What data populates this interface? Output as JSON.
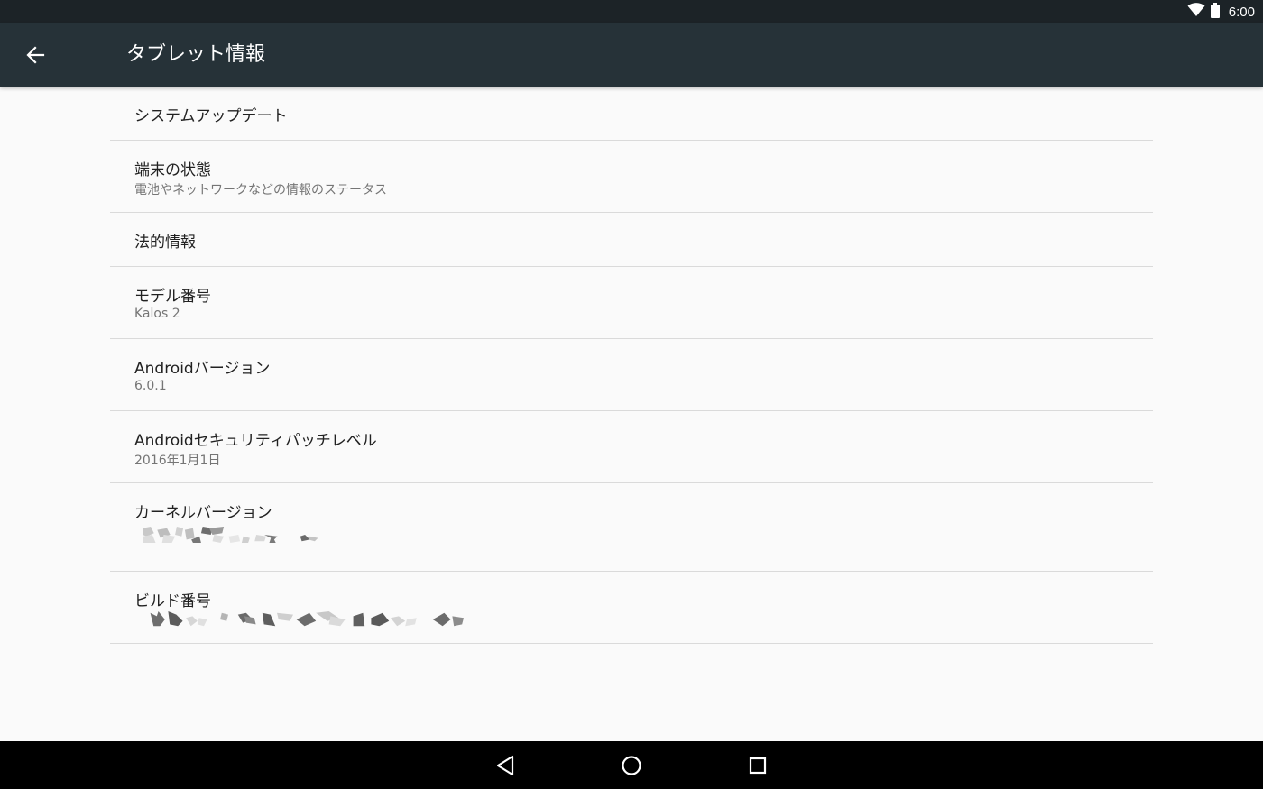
{
  "status_bar": {
    "time": "6:00",
    "icons": [
      "wifi-icon",
      "battery-icon"
    ]
  },
  "app_bar": {
    "title": "タブレット情報",
    "back_icon": "arrow-back-icon",
    "background": "#263238"
  },
  "items": [
    {
      "title": "システムアップデート"
    },
    {
      "title": "端末の状態",
      "summary": "電池やネットワークなどの情報のステータス"
    },
    {
      "title": "法的情報"
    },
    {
      "title": "モデル番号",
      "summary": "Kalos 2"
    },
    {
      "title": "Androidバージョン",
      "summary": "6.0.1"
    },
    {
      "title": "Androidセキュリティパッチレベル",
      "summary": "2016年1月1日"
    },
    {
      "title": "カーネルバージョン",
      "summary_obscured": true
    },
    {
      "title": "ビルド番号",
      "summary_obscured": true
    }
  ],
  "nav_bar": {
    "buttons": [
      "back-icon",
      "home-icon",
      "recents-icon"
    ]
  }
}
